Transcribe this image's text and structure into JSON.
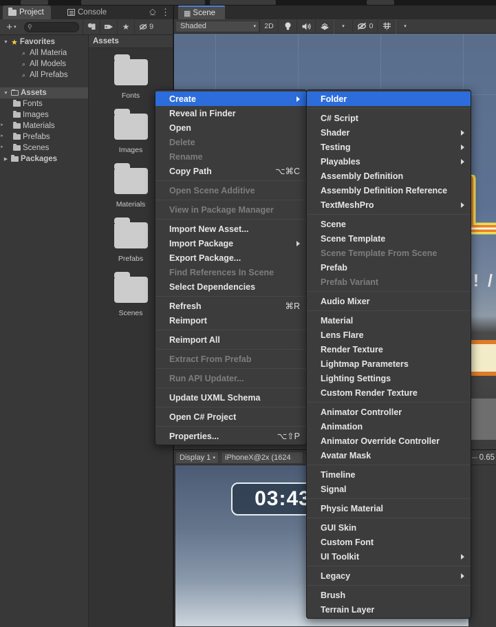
{
  "window": {
    "background": "#191919",
    "accent": "#2c6ddb"
  },
  "project_panel": {
    "tabs": [
      {
        "label": "Project",
        "icon": "folder-icon",
        "active": true
      },
      {
        "label": "Console",
        "icon": "console-icon",
        "active": false
      }
    ],
    "tab_controls": [
      {
        "name": "lock-icon",
        "glyph": "⎐"
      },
      {
        "name": "more-options-icon",
        "glyph": "⋮"
      }
    ],
    "toolbar": {
      "create_label": "+",
      "create_caret": "▾",
      "search_placeholder": "",
      "search_value": "",
      "search_icon": "search-icon",
      "filters": [
        {
          "name": "save-filter-icon",
          "glyph": "⬚"
        },
        {
          "name": "label-filter-icon",
          "glyph": "⬟"
        },
        {
          "name": "favorite-filter-icon",
          "glyph": "★"
        },
        {
          "name": "hidden-packages-icon",
          "glyph": "⊘",
          "count": "9"
        }
      ]
    },
    "tree": [
      {
        "label": "Favorites",
        "depth": 0,
        "arrow": "▼",
        "icon": "star-icon",
        "selected": false
      },
      {
        "label": "All Materia",
        "depth": 2,
        "arrow": "",
        "icon": "search-icon",
        "selected": false
      },
      {
        "label": "All Models",
        "depth": 2,
        "arrow": "",
        "icon": "search-icon",
        "selected": false
      },
      {
        "label": "All Prefabs",
        "depth": 2,
        "arrow": "",
        "icon": "search-icon",
        "selected": false
      },
      {
        "label": "",
        "depth": 0,
        "arrow": "",
        "icon": "",
        "selected": false
      },
      {
        "label": "Assets",
        "depth": 0,
        "arrow": "▼",
        "icon": "folder-open-icon",
        "selected": true
      },
      {
        "label": "Fonts",
        "depth": 1,
        "arrow": "",
        "icon": "folder-icon",
        "selected": false
      },
      {
        "label": "Images",
        "depth": 1,
        "arrow": "",
        "icon": "folder-icon",
        "selected": false
      },
      {
        "label": "Materials",
        "depth": 1,
        "arrow": "",
        "icon": "folder-icon",
        "selected": false
      },
      {
        "label": "Prefabs",
        "depth": 1,
        "arrow": "",
        "icon": "folder-icon",
        "selected": false
      },
      {
        "label": "Scenes",
        "depth": 1,
        "arrow": "",
        "icon": "folder-icon",
        "selected": false
      },
      {
        "label": "Packages",
        "depth": 0,
        "arrow": "▶",
        "icon": "folder-icon",
        "selected": false
      }
    ],
    "grid": {
      "breadcrumb": "Assets",
      "items": [
        {
          "label": "Fonts",
          "icon": "folder-icon"
        },
        {
          "label": "Images",
          "icon": "folder-icon"
        },
        {
          "label": "Materials",
          "icon": "folder-icon"
        },
        {
          "label": "Prefabs",
          "icon": "folder-icon"
        },
        {
          "label": "Scenes",
          "icon": "folder-icon"
        }
      ]
    }
  },
  "scene_panel": {
    "tab": {
      "label": "Scene",
      "icon": "grid-icon"
    },
    "toolbar": {
      "draw_mode": "Shaded",
      "draw_mode_caret": "▾",
      "two_d_label": "2D",
      "lighting_icon": "lightbulb-icon",
      "audio_icon": "speaker-icon",
      "fx_icon": "effects-icon",
      "fx_caret": "▾",
      "hidden_objects_icon": "visibility-off-icon",
      "hidden_objects_count": "0",
      "grid_icon": "scene-grid-icon",
      "grid_caret": "▾"
    },
    "viewport_text": "! /"
  },
  "game_panel": {
    "toolbar": {
      "display": "Display 1",
      "display_caret": "▾",
      "resolution": "iPhoneX@2x (1624",
      "scale_label": "",
      "scale_value": "0.65"
    },
    "hud": {
      "timer": "03:43"
    }
  },
  "context_menu": {
    "name": "project-context-menu",
    "items": [
      {
        "label": "Create",
        "type": "item",
        "highlight": true,
        "submenu": true
      },
      {
        "label": "Reveal in Finder",
        "type": "item"
      },
      {
        "label": "Open",
        "type": "item"
      },
      {
        "label": "Delete",
        "type": "item",
        "disabled": true
      },
      {
        "label": "Rename",
        "type": "item",
        "disabled": true
      },
      {
        "label": "Copy Path",
        "type": "item",
        "shortcut": "⌥⌘C"
      },
      {
        "type": "separator"
      },
      {
        "label": "Open Scene Additive",
        "type": "item",
        "disabled": true
      },
      {
        "type": "separator"
      },
      {
        "label": "View in Package Manager",
        "type": "item",
        "disabled": true
      },
      {
        "type": "separator"
      },
      {
        "label": "Import New Asset...",
        "type": "item"
      },
      {
        "label": "Import Package",
        "type": "item",
        "submenu": true
      },
      {
        "label": "Export Package...",
        "type": "item"
      },
      {
        "label": "Find References In Scene",
        "type": "item",
        "disabled": true
      },
      {
        "label": "Select Dependencies",
        "type": "item"
      },
      {
        "type": "separator"
      },
      {
        "label": "Refresh",
        "type": "item",
        "shortcut": "⌘R"
      },
      {
        "label": "Reimport",
        "type": "item"
      },
      {
        "type": "separator"
      },
      {
        "label": "Reimport All",
        "type": "item"
      },
      {
        "type": "separator"
      },
      {
        "label": "Extract From Prefab",
        "type": "item",
        "disabled": true
      },
      {
        "type": "separator"
      },
      {
        "label": "Run API Updater...",
        "type": "item",
        "disabled": true
      },
      {
        "type": "separator"
      },
      {
        "label": "Update UXML Schema",
        "type": "item"
      },
      {
        "type": "separator"
      },
      {
        "label": "Open C# Project",
        "type": "item"
      },
      {
        "type": "separator"
      },
      {
        "label": "Properties...",
        "type": "item",
        "shortcut": "⌥⇧P"
      }
    ]
  },
  "create_submenu": {
    "name": "create-submenu",
    "items": [
      {
        "label": "Folder",
        "type": "item",
        "highlight": true
      },
      {
        "type": "separator"
      },
      {
        "label": "C# Script",
        "type": "item"
      },
      {
        "label": "Shader",
        "type": "item",
        "submenu": true
      },
      {
        "label": "Testing",
        "type": "item",
        "submenu": true
      },
      {
        "label": "Playables",
        "type": "item",
        "submenu": true
      },
      {
        "label": "Assembly Definition",
        "type": "item"
      },
      {
        "label": "Assembly Definition Reference",
        "type": "item"
      },
      {
        "label": "TextMeshPro",
        "type": "item",
        "submenu": true
      },
      {
        "type": "separator"
      },
      {
        "label": "Scene",
        "type": "item"
      },
      {
        "label": "Scene Template",
        "type": "item"
      },
      {
        "label": "Scene Template From Scene",
        "type": "item",
        "disabled": true
      },
      {
        "label": "Prefab",
        "type": "item"
      },
      {
        "label": "Prefab Variant",
        "type": "item",
        "disabled": true
      },
      {
        "type": "separator"
      },
      {
        "label": "Audio Mixer",
        "type": "item"
      },
      {
        "type": "separator"
      },
      {
        "label": "Material",
        "type": "item"
      },
      {
        "label": "Lens Flare",
        "type": "item"
      },
      {
        "label": "Render Texture",
        "type": "item"
      },
      {
        "label": "Lightmap Parameters",
        "type": "item"
      },
      {
        "label": "Lighting Settings",
        "type": "item"
      },
      {
        "label": "Custom Render Texture",
        "type": "item"
      },
      {
        "type": "separator"
      },
      {
        "label": "Animator Controller",
        "type": "item"
      },
      {
        "label": "Animation",
        "type": "item"
      },
      {
        "label": "Animator Override Controller",
        "type": "item"
      },
      {
        "label": "Avatar Mask",
        "type": "item"
      },
      {
        "type": "separator"
      },
      {
        "label": "Timeline",
        "type": "item"
      },
      {
        "label": "Signal",
        "type": "item"
      },
      {
        "type": "separator"
      },
      {
        "label": "Physic Material",
        "type": "item"
      },
      {
        "type": "separator"
      },
      {
        "label": "GUI Skin",
        "type": "item"
      },
      {
        "label": "Custom Font",
        "type": "item"
      },
      {
        "label": "UI Toolkit",
        "type": "item",
        "submenu": true
      },
      {
        "type": "separator"
      },
      {
        "label": "Legacy",
        "type": "item",
        "submenu": true
      },
      {
        "type": "separator"
      },
      {
        "label": "Brush",
        "type": "item"
      },
      {
        "label": "Terrain Layer",
        "type": "item"
      }
    ]
  }
}
